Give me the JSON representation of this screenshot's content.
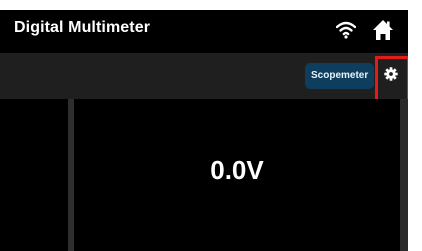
{
  "header": {
    "title": "Digital Multimeter",
    "icons": [
      "wifi-icon",
      "home-icon"
    ]
  },
  "toolbar": {
    "scope_label": "Scopemeter",
    "settings_icon": "gear-icon",
    "highlight_color": "#e21b1b"
  },
  "display": {
    "reading": "0.0V"
  },
  "colors": {
    "background": "#000000",
    "toolbar": "#1f1f1f",
    "scope_button": "#0f3d5e"
  }
}
